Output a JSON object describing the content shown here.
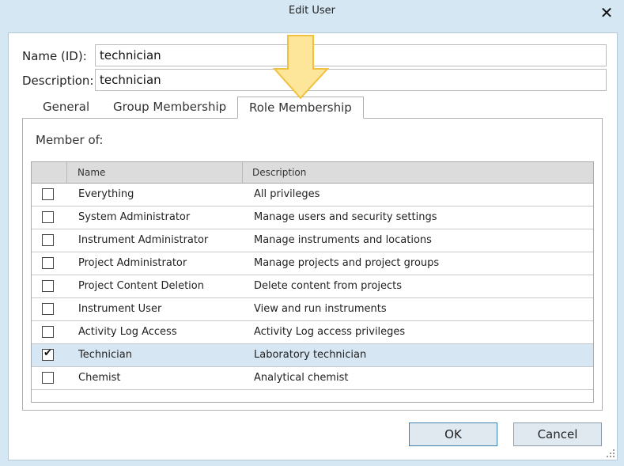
{
  "window": {
    "title": "Edit User",
    "close_glyph": "✕"
  },
  "form": {
    "name_label": "Name (ID):",
    "name_value": "technician",
    "description_label": "Description:",
    "description_value": "technician"
  },
  "tabs": [
    {
      "label": "General",
      "active": false
    },
    {
      "label": "Group Membership",
      "active": false
    },
    {
      "label": "Role Membership",
      "active": true
    }
  ],
  "panel": {
    "member_of_label": "Member of:",
    "columns": [
      "Name",
      "Description"
    ],
    "rows": [
      {
        "name": "Everything",
        "description": "All privileges",
        "checked": false
      },
      {
        "name": "System Administrator",
        "description": "Manage users and security settings",
        "checked": false
      },
      {
        "name": "Instrument Administrator",
        "description": "Manage instruments and locations",
        "checked": false
      },
      {
        "name": "Project Administrator",
        "description": "Manage projects and project groups",
        "checked": false
      },
      {
        "name": "Project Content Deletion",
        "description": "Delete content from projects",
        "checked": false
      },
      {
        "name": "Instrument User",
        "description": "View and run instruments",
        "checked": false
      },
      {
        "name": "Activity Log Access",
        "description": "Activity Log access privileges",
        "checked": false
      },
      {
        "name": "Technician",
        "description": "Laboratory technician",
        "checked": true
      },
      {
        "name": "Chemist",
        "description": "Analytical chemist",
        "checked": false
      }
    ]
  },
  "buttons": {
    "ok_label": "OK",
    "cancel_label": "Cancel"
  },
  "icons": {
    "close": "close-icon",
    "check": "checkmark-icon",
    "arrow": "arrow-down-icon",
    "grip": "resize-grip-icon"
  },
  "colors": {
    "selected_row": "#d7e6f3",
    "arrow_fill": "#fde59a",
    "arrow_stroke": "#f0c040",
    "default_button_border": "#3c7fb1"
  }
}
